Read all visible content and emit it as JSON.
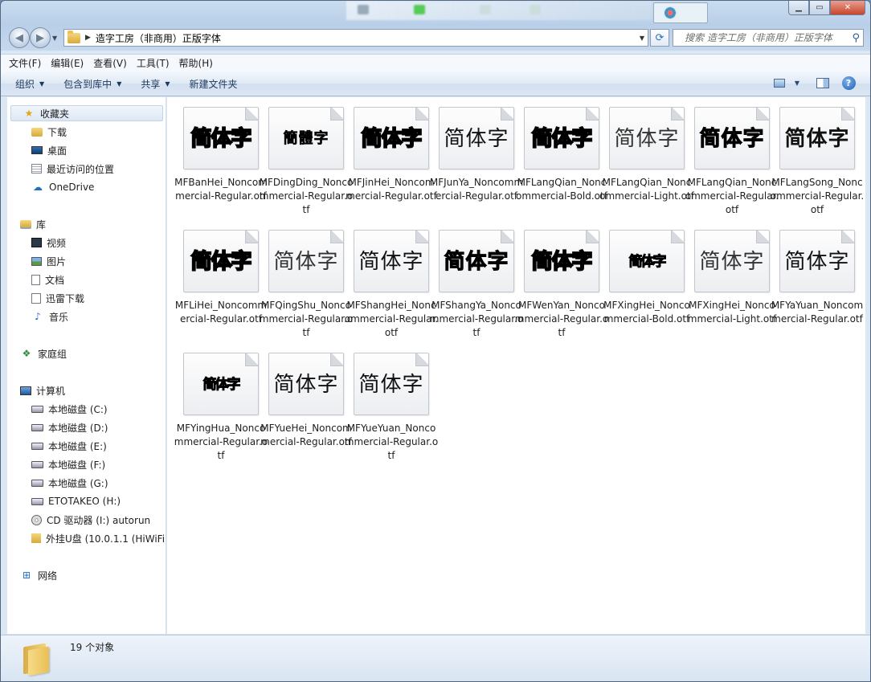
{
  "window": {
    "path": "造字工房（非商用）正版字体",
    "search_placeholder": "搜索 造字工房（非商用）正版字体"
  },
  "menu": [
    "文件(F)",
    "编辑(E)",
    "查看(V)",
    "工具(T)",
    "帮助(H)"
  ],
  "toolbar": {
    "organize": "组织",
    "include_library": "包含到库中",
    "share": "共享",
    "new_folder": "新建文件夹"
  },
  "nav": {
    "favorites": "收藏夹",
    "downloads": "下载",
    "desktop": "桌面",
    "recent": "最近访问的位置",
    "onedrive": "OneDrive",
    "libraries": "库",
    "videos": "视频",
    "pictures": "图片",
    "documents": "文档",
    "thunder": "迅雷下载",
    "music": "音乐",
    "homegroup": "家庭组",
    "computer": "计算机",
    "drive_c": "本地磁盘 (C:)",
    "drive_d": "本地磁盘 (D:)",
    "drive_e": "本地磁盘 (E:)",
    "drive_f": "本地磁盘 (F:)",
    "drive_g": "本地磁盘 (G:)",
    "drive_h": "ETOTAKEO (H:)",
    "drive_i": "CD 驱动器 (I:) autorun",
    "drive_usb": "外挂U盘 (10.0.1.1 (HiWiFi",
    "network": "网络"
  },
  "files": [
    {
      "name": "MFBanHei_Noncommercial-Regular.otf",
      "glyph": "简体字",
      "style": "heavy"
    },
    {
      "name": "MFDingDing_Noncommercial-Regular.otf",
      "glyph": "簡體字",
      "style": "small"
    },
    {
      "name": "MFJinHei_Noncommercial-Regular.otf",
      "glyph": "简体字",
      "style": "heavy"
    },
    {
      "name": "MFJunYa_Noncommercial-Regular.otf",
      "glyph": "简体字",
      "style": "regular"
    },
    {
      "name": "MFLangQian_Noncommercial-Bold.otf",
      "glyph": "简体字",
      "style": "heavy"
    },
    {
      "name": "MFLangQian_Noncommercial-Light.otf",
      "glyph": "简体字",
      "style": "light"
    },
    {
      "name": "MFLangQian_Noncommercial-Regular.otf",
      "glyph": "简体字",
      "style": "bold"
    },
    {
      "name": "MFLangSong_Noncommercial-Regular.otf",
      "glyph": "简体字",
      "style": "serif"
    },
    {
      "name": "MFLiHei_Noncommercial-Regular.otf",
      "glyph": "简体字",
      "style": "heavy"
    },
    {
      "name": "MFQingShu_Noncommercial-Regular.otf",
      "glyph": "简体字",
      "style": "light"
    },
    {
      "name": "MFShangHei_Noncommercial-Regular.otf",
      "glyph": "简体字",
      "style": "regular"
    },
    {
      "name": "MFShangYa_Noncommercial-Regular.otf",
      "glyph": "简体字",
      "style": "bold"
    },
    {
      "name": "MFWenYan_Noncommercial-Regular.otf",
      "glyph": "简体字",
      "style": "heavy"
    },
    {
      "name": "MFXingHei_Noncommercial-Bold.otf",
      "glyph": "简体字",
      "style": "tiny"
    },
    {
      "name": "MFXingHei_Noncommercial-Light.otf",
      "glyph": "简体字",
      "style": "light"
    },
    {
      "name": "MFYaYuan_Noncommercial-Regular.otf",
      "glyph": "简体字",
      "style": "regular"
    },
    {
      "name": "MFYingHua_Noncommercial-Regular.otf",
      "glyph": "简体字",
      "style": "tiny"
    },
    {
      "name": "MFYueHei_Noncommercial-Regular.otf",
      "glyph": "简体字",
      "style": "regular"
    },
    {
      "name": "MFYueYuan_Noncommercial-Regular.otf",
      "glyph": "简体字",
      "style": "regular"
    }
  ],
  "status": {
    "count": "19 个对象"
  }
}
